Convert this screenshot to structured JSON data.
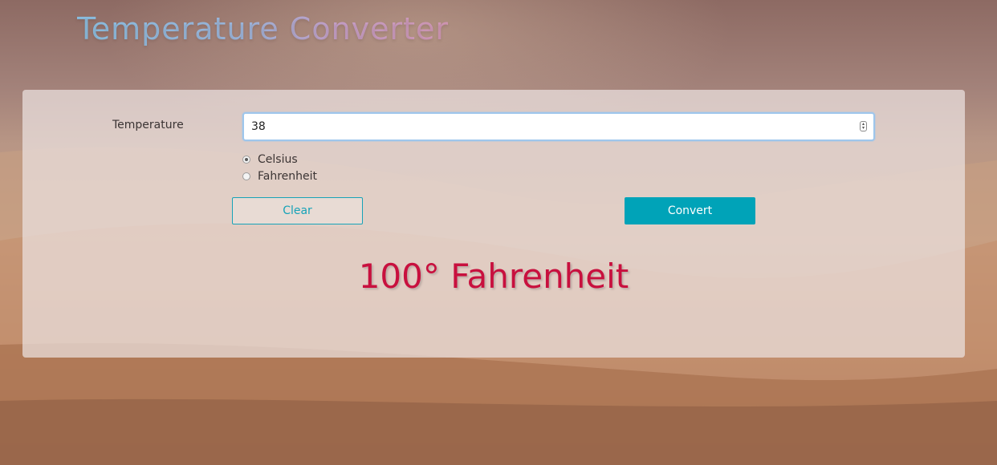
{
  "app": {
    "title": "Temperature Converter"
  },
  "form": {
    "temperature_label": "Temperature",
    "temperature_value": "38",
    "units": [
      {
        "label": "Celsius",
        "checked": true
      },
      {
        "label": "Fahrenheit",
        "checked": false
      }
    ],
    "clear_label": "Clear",
    "convert_label": "Convert"
  },
  "result": {
    "text": "100° Fahrenheit"
  },
  "colors": {
    "accent": "#00a3b8",
    "result": "#c8103e",
    "input_focus_border": "#9ec6ec"
  },
  "icons": {
    "spinner": "number-spinner-icon"
  }
}
